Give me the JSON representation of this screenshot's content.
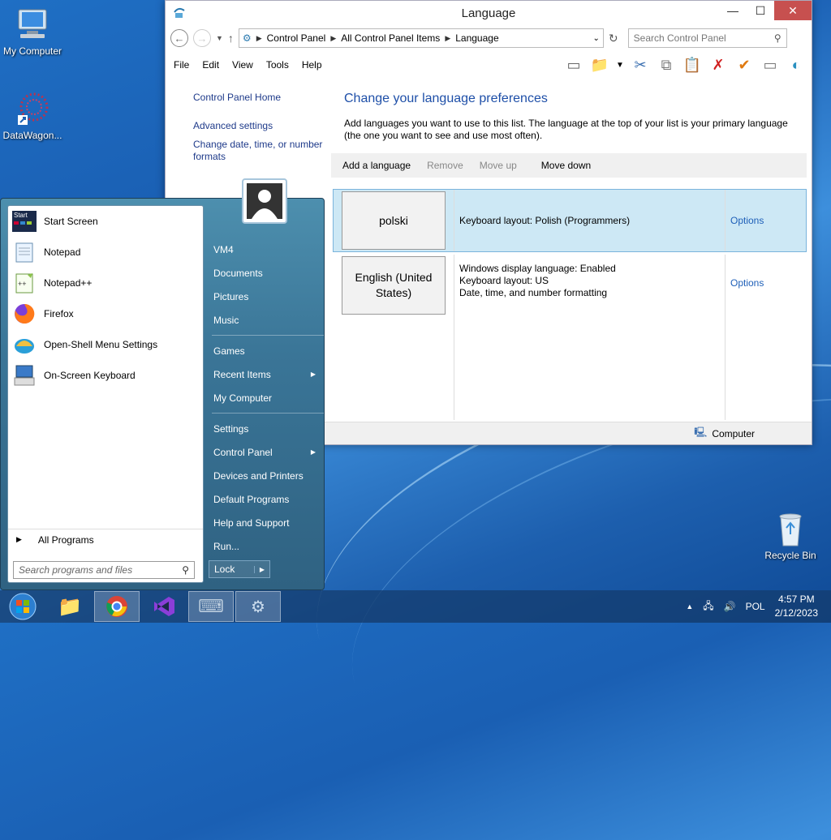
{
  "desktop": {
    "icons": [
      {
        "label": "My Computer"
      },
      {
        "label": "DataWagon..."
      },
      {
        "label": "Recycle Bin"
      }
    ]
  },
  "window": {
    "title": "Language",
    "breadcrumb": [
      "Control Panel",
      "All Control Panel Items",
      "Language"
    ],
    "search_placeholder": "Search Control Panel",
    "menu": [
      "File",
      "Edit",
      "View",
      "Tools",
      "Help"
    ],
    "left_links": [
      "Control Panel Home",
      "Advanced settings",
      "Change date, time, or number formats"
    ],
    "heading": "Change your language preferences",
    "description": "Add languages you want to use to this list. The language at the top of your list is your primary language (the one you want to see and use most often).",
    "commands": {
      "add": "Add a language",
      "remove": "Remove",
      "up": "Move up",
      "down": "Move down"
    },
    "languages": [
      {
        "name": "polski",
        "info": [
          "Keyboard layout: Polish (Programmers)"
        ],
        "options": "Options"
      },
      {
        "name": "English (United States)",
        "info": [
          "Windows display language: Enabled",
          "Keyboard layout: US",
          "Date, time, and number formatting"
        ],
        "options": "Options"
      }
    ],
    "status": "Computer"
  },
  "start_menu": {
    "programs": [
      "Start Screen",
      "Notepad",
      "Notepad++",
      "Firefox",
      "Open-Shell Menu Settings",
      "On-Screen Keyboard"
    ],
    "all_programs": "All Programs",
    "search_placeholder": "Search programs and files",
    "right": {
      "user": "VM4",
      "items1": [
        "Documents",
        "Pictures",
        "Music"
      ],
      "items2": [
        "Games",
        "Recent Items",
        "My Computer"
      ],
      "items3": [
        "Settings",
        "Control Panel",
        "Devices and Printers",
        "Default Programs",
        "Help and Support",
        "Run..."
      ]
    },
    "lock": "Lock"
  },
  "taskbar": {
    "lang": "POL",
    "time": "4:57 PM",
    "date": "2/12/2023"
  }
}
